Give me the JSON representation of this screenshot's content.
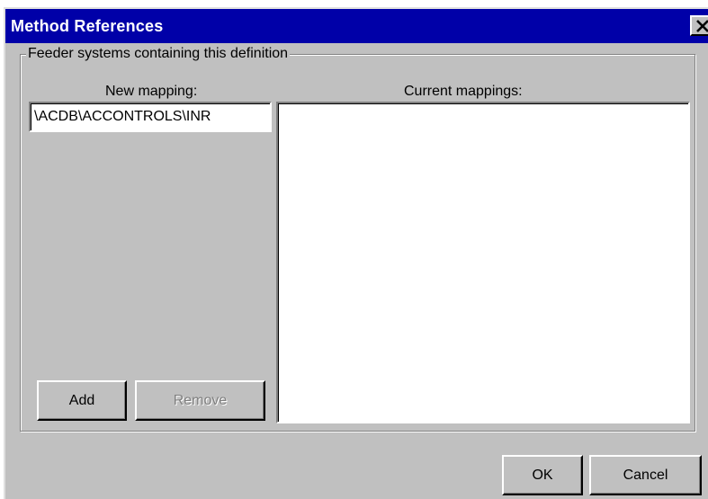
{
  "window": {
    "title": "Method References"
  },
  "group": {
    "legend": "Feeder systems containing this definition"
  },
  "new_mapping": {
    "label": "New mapping:",
    "value": "\\ACDB\\ACCONTROLS\\INR"
  },
  "current_mappings": {
    "label": "Current mappings:",
    "items": []
  },
  "buttons": {
    "add": "Add",
    "remove": "Remove",
    "ok": "OK",
    "cancel": "Cancel"
  },
  "icons": {
    "close": "close-icon"
  },
  "colors": {
    "titlebar": "#0000a8",
    "face": "#c0c0c0",
    "disabled_text": "#808080"
  }
}
